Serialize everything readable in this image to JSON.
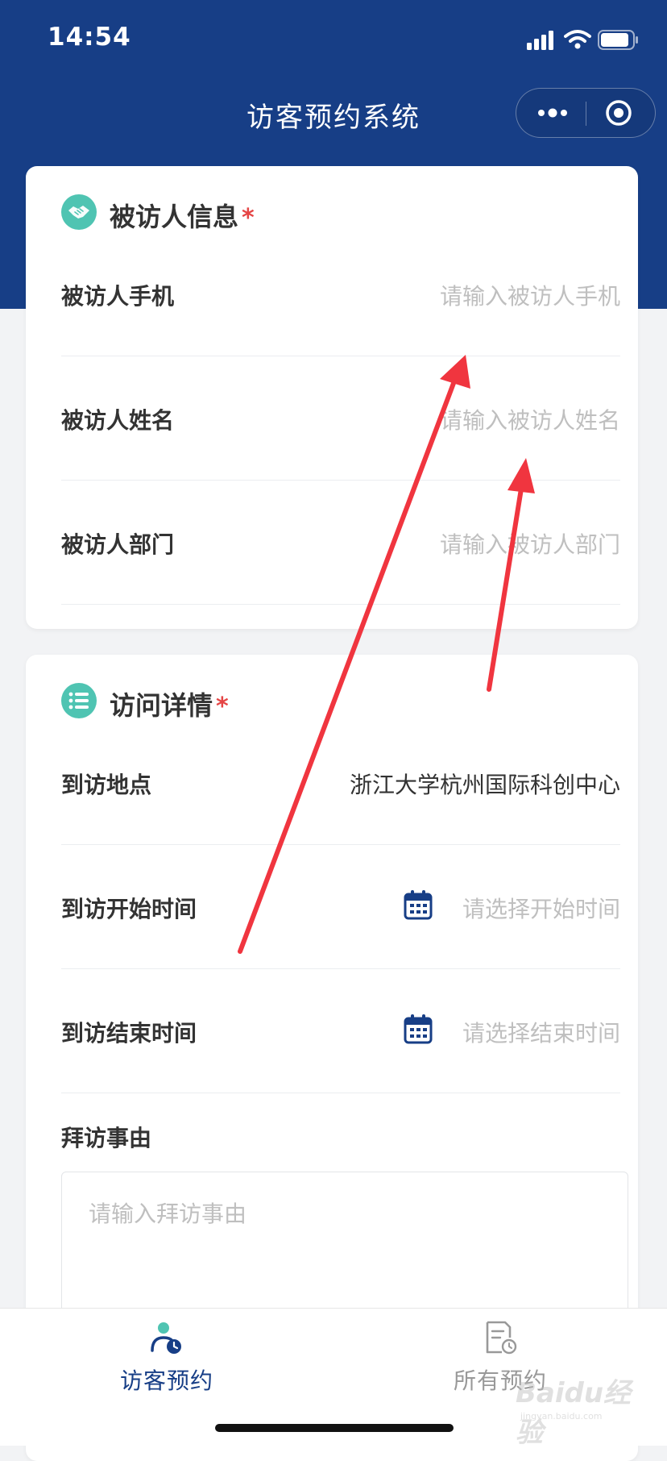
{
  "status_bar": {
    "time": "14:54"
  },
  "nav": {
    "title": "访客预约系统"
  },
  "host_section": {
    "title": "被访人信息",
    "required_mark": "*",
    "fields": [
      {
        "label": "被访人手机",
        "placeholder": "请输入被访人手机"
      },
      {
        "label": "被访人姓名",
        "placeholder": "请输入被访人姓名"
      },
      {
        "label": "被访人部门",
        "placeholder": "请输入被访人部门"
      }
    ]
  },
  "visit_section": {
    "title": "访问详情",
    "required_mark": "*",
    "location": {
      "label": "到访地点",
      "value": "浙江大学杭州国际科创中心"
    },
    "start_time": {
      "label": "到访开始时间",
      "placeholder": "请选择开始时间"
    },
    "end_time": {
      "label": "到访结束时间",
      "placeholder": "请选择结束时间"
    },
    "reason": {
      "label": "拜访事由",
      "placeholder": "请输入拜访事由"
    }
  },
  "tabbar": {
    "tabs": [
      {
        "label": "访客预约",
        "active": true
      },
      {
        "label": "所有预约",
        "active": false
      }
    ]
  },
  "watermark": {
    "main": "Baidu经验",
    "sub": "jingyan.baidu.com"
  },
  "colors": {
    "header": "#173e86",
    "section_icon": "#4fc4b2",
    "required": "#e54545",
    "annotation_arrow": "#f0353f",
    "active_tab": "#173e86"
  }
}
